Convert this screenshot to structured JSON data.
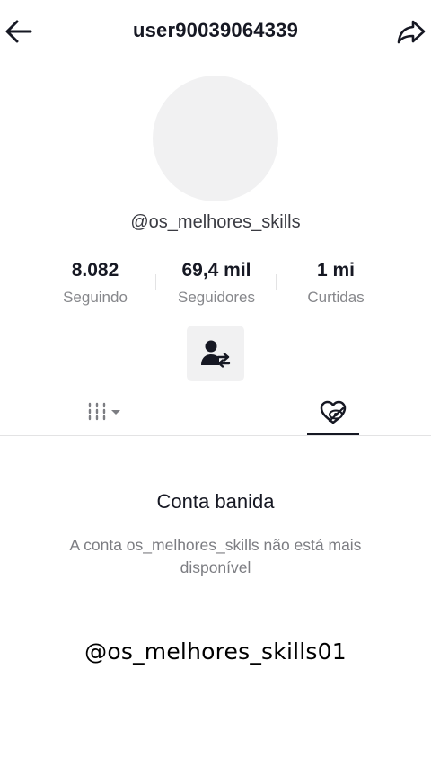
{
  "header": {
    "title": "user90039064339",
    "back_icon": "arrow-left-icon",
    "share_icon": "share-arrow-icon"
  },
  "profile": {
    "handle": "@os_melhores_skills",
    "avatar_color": "#f1f1f2"
  },
  "stats": [
    {
      "value": "8.082",
      "label": "Seguindo"
    },
    {
      "value": "69,4 mil",
      "label": "Seguidores"
    },
    {
      "value": "1 mi",
      "label": "Curtidas"
    }
  ],
  "actions": {
    "friend_icon": "add-friend-swap-icon"
  },
  "tabs": [
    {
      "icon": "grid-bars-icon",
      "dropdown_icon": "caret-down-icon",
      "active": false
    },
    {
      "icon": "liked-heart-hidden-icon",
      "active": true
    }
  ],
  "banned": {
    "title": "Conta banida",
    "description": "A conta os_melhores_skills não está mais disponível"
  },
  "overlay": {
    "text": "@os_melhores_skills01"
  },
  "colors": {
    "text_primary": "#161823",
    "text_secondary": "#86878b",
    "surface": "#f1f1f2",
    "divider": "#e3e3e4"
  }
}
